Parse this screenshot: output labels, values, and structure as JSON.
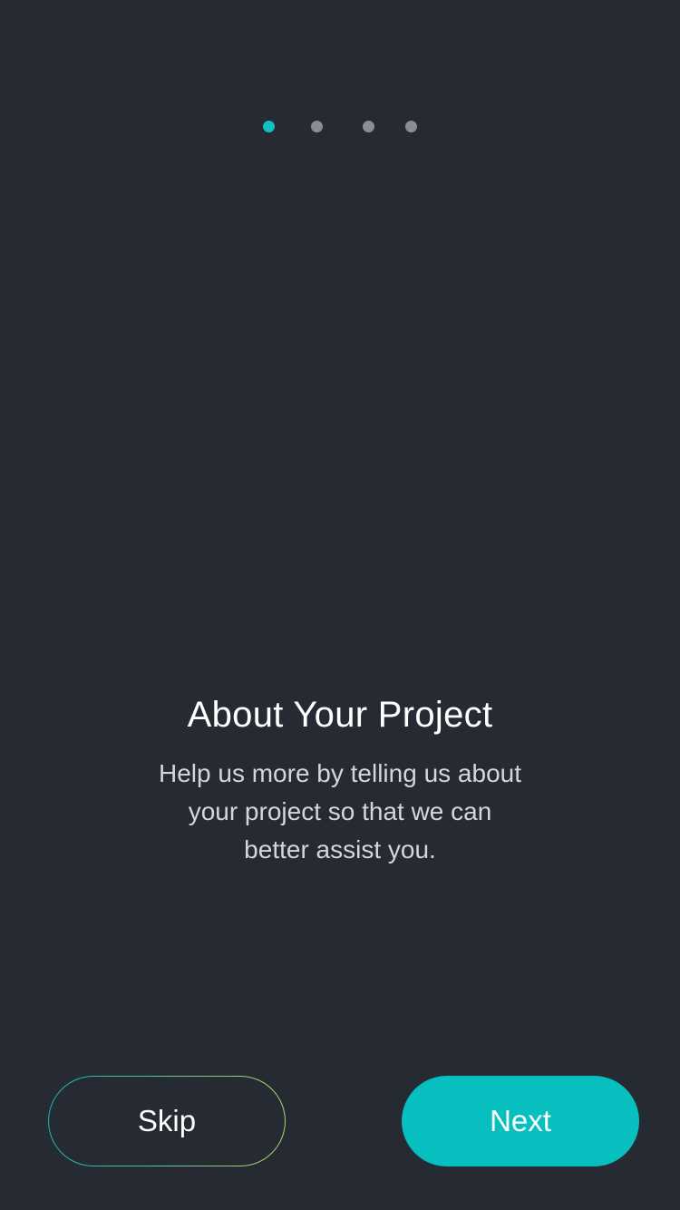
{
  "pager": {
    "total_pages": 4,
    "current_page": 1,
    "active_color": "#13c2c0",
    "inactive_color": "#8a8d93"
  },
  "content": {
    "title": "About Your Project",
    "description": "Help us more by telling us about your project so that we can better assist you."
  },
  "actions": {
    "skip_label": "Skip",
    "next_label": "Next"
  },
  "colors": {
    "background": "#252a33",
    "accent": "#07bfbf",
    "skip_border_gradient_start": "#12b8b3",
    "skip_border_gradient_end": "#b6d36a"
  }
}
